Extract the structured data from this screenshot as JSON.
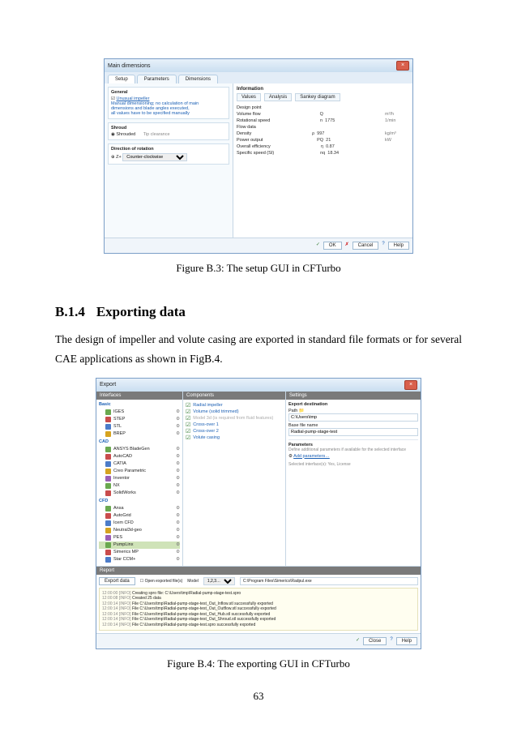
{
  "fig3": {
    "caption": "Figure B.3: The setup GUI in CFTurbo",
    "window_title": "Main dimensions",
    "tabs": [
      "Setup",
      "Parameters",
      "Dimensions"
    ],
    "right_panel_title": "Information",
    "sub_tabs": [
      "Values",
      "Analysis",
      "Sankey diagram"
    ],
    "group_general": "General",
    "general_label": "Unusual impeller",
    "general_note1": "Manual dimensioning; no calculation of main",
    "general_note2": "dimensions and blade angles executed,",
    "general_note3": "all values have to be specified manually",
    "group_shroud": "Shroud",
    "shroud_option": "Shrouded",
    "shroud_tip": "Tip clearance",
    "group_rotation": "Direction of rotation",
    "rotation_value": "Counter-clockwise",
    "rotation_extra": "Z+",
    "kv": [
      {
        "k": "Design point",
        "v": "",
        "u": ""
      },
      {
        "k": "Volume flow",
        "v": "Q",
        "n": "",
        "u": "m³/h"
      },
      {
        "k": "Rotational speed",
        "v": "n",
        "n": "1775",
        "u": "1/min"
      },
      {
        "k": "Flow data",
        "v": "",
        "n": "",
        "u": ""
      },
      {
        "k": "Density",
        "v": "ρ",
        "n": "997",
        "u": "kg/m³"
      },
      {
        "k": "Power output",
        "v": "PQ",
        "n": "21",
        "u": "kW"
      },
      {
        "k": "Overall efficiency",
        "v": "η",
        "n": "0.87",
        "u": ""
      },
      {
        "k": "Specific speed (SI)",
        "v": "nq",
        "n": "18.34",
        "u": ""
      }
    ],
    "footer": [
      "OK",
      "Cancel",
      "Help"
    ]
  },
  "section": {
    "number": "B.1.4",
    "title": "Exporting data",
    "paragraph": "The design of impeller and volute casing are exported in standard file formats or for several CAE applications as shown in FigB.4."
  },
  "fig4": {
    "caption": "Figure B.4: The exporting GUI in CFTurbo",
    "window_title": "Export",
    "col1_title": "Interfaces",
    "col2_title": "Components",
    "col3_title": "Settings",
    "group_basic": "Basic",
    "basic_items": [
      "IGES",
      "STEP",
      "STL",
      "BREP"
    ],
    "group_cad": "CAD",
    "cad_items": [
      "ANSYS BladeGen",
      "AutoCAD",
      "CATIA",
      "Creo Parametric",
      "Inventor",
      "NX",
      "SolidWorks"
    ],
    "group_cfd": "CFD",
    "cfd_items": [
      "Ansa",
      "AutoGrid",
      "Icem CFD",
      "Neutral3d-geo",
      "PES",
      "PumpLinx",
      "Simerics MP",
      "Star CCM+"
    ],
    "comp": [
      {
        "label": "Radial impeller",
        "chk": true
      },
      {
        "label": "Volume (solid trimmed)",
        "chk": true
      },
      {
        "label": "Model 3d (is required from fluid features)",
        "chk": false,
        "gray": true
      },
      {
        "label": "Cross-over 1",
        "chk": true
      },
      {
        "label": "Cross-over 2",
        "chk": true
      },
      {
        "label": "Volute casing",
        "chk": true
      }
    ],
    "settings_path_label": "Export destination",
    "settings_path": "Path",
    "settings_path_value": "C:\\Users\\tmp",
    "settings_base_label": "Base file name",
    "settings_base_value": "Radial-pump-stage-test",
    "settings_params_label": "Parameters",
    "settings_params_hint": "Define additional parameters if available for the selected interface",
    "settings_add_link": "Add parameters…",
    "settings_selected": "Selected interface(s): Yes, License",
    "report_title": "Report",
    "report_btn": "Export data",
    "report_open": "Open exported file(s)",
    "report_model": "Model",
    "report_path_value": "C:\\Program Files\\Simerics\\Radpul.exe",
    "log": [
      {
        "t": "12:00:00",
        "tag": "[INFO]",
        "m": "Creating spro file: C:\\Users\\tmp\\Radial-pump-stage-test.spro"
      },
      {
        "t": "12:00:08",
        "tag": "[INFO]",
        "m": "Created 25 data"
      },
      {
        "t": "12:00:14",
        "tag": "[INFO]",
        "m": "File C:\\Users\\tmp\\Radial-pump-stage-test_Out_Inflow.stl successfully exported"
      },
      {
        "t": "12:00:14",
        "tag": "[INFO]",
        "m": "File C:\\Users\\tmp\\Radial-pump-stage-test_Out_Outflow.stl successfully exported"
      },
      {
        "t": "12:00:14",
        "tag": "[INFO]",
        "m": "File C:\\Users\\tmp\\Radial-pump-stage-test_Out_Hub.stl successfully exported"
      },
      {
        "t": "12:00:14",
        "tag": "[INFO]",
        "m": "File C:\\Users\\tmp\\Radial-pump-stage-test_Out_Shroud.stl successfully exported"
      },
      {
        "t": "12:00:14",
        "tag": "[INFO]",
        "m": "File C:\\Users\\tmp\\Radial-pump-stage-test.spro successfully exported"
      }
    ],
    "footer": [
      "Close",
      "Help"
    ]
  },
  "page_number": "63"
}
